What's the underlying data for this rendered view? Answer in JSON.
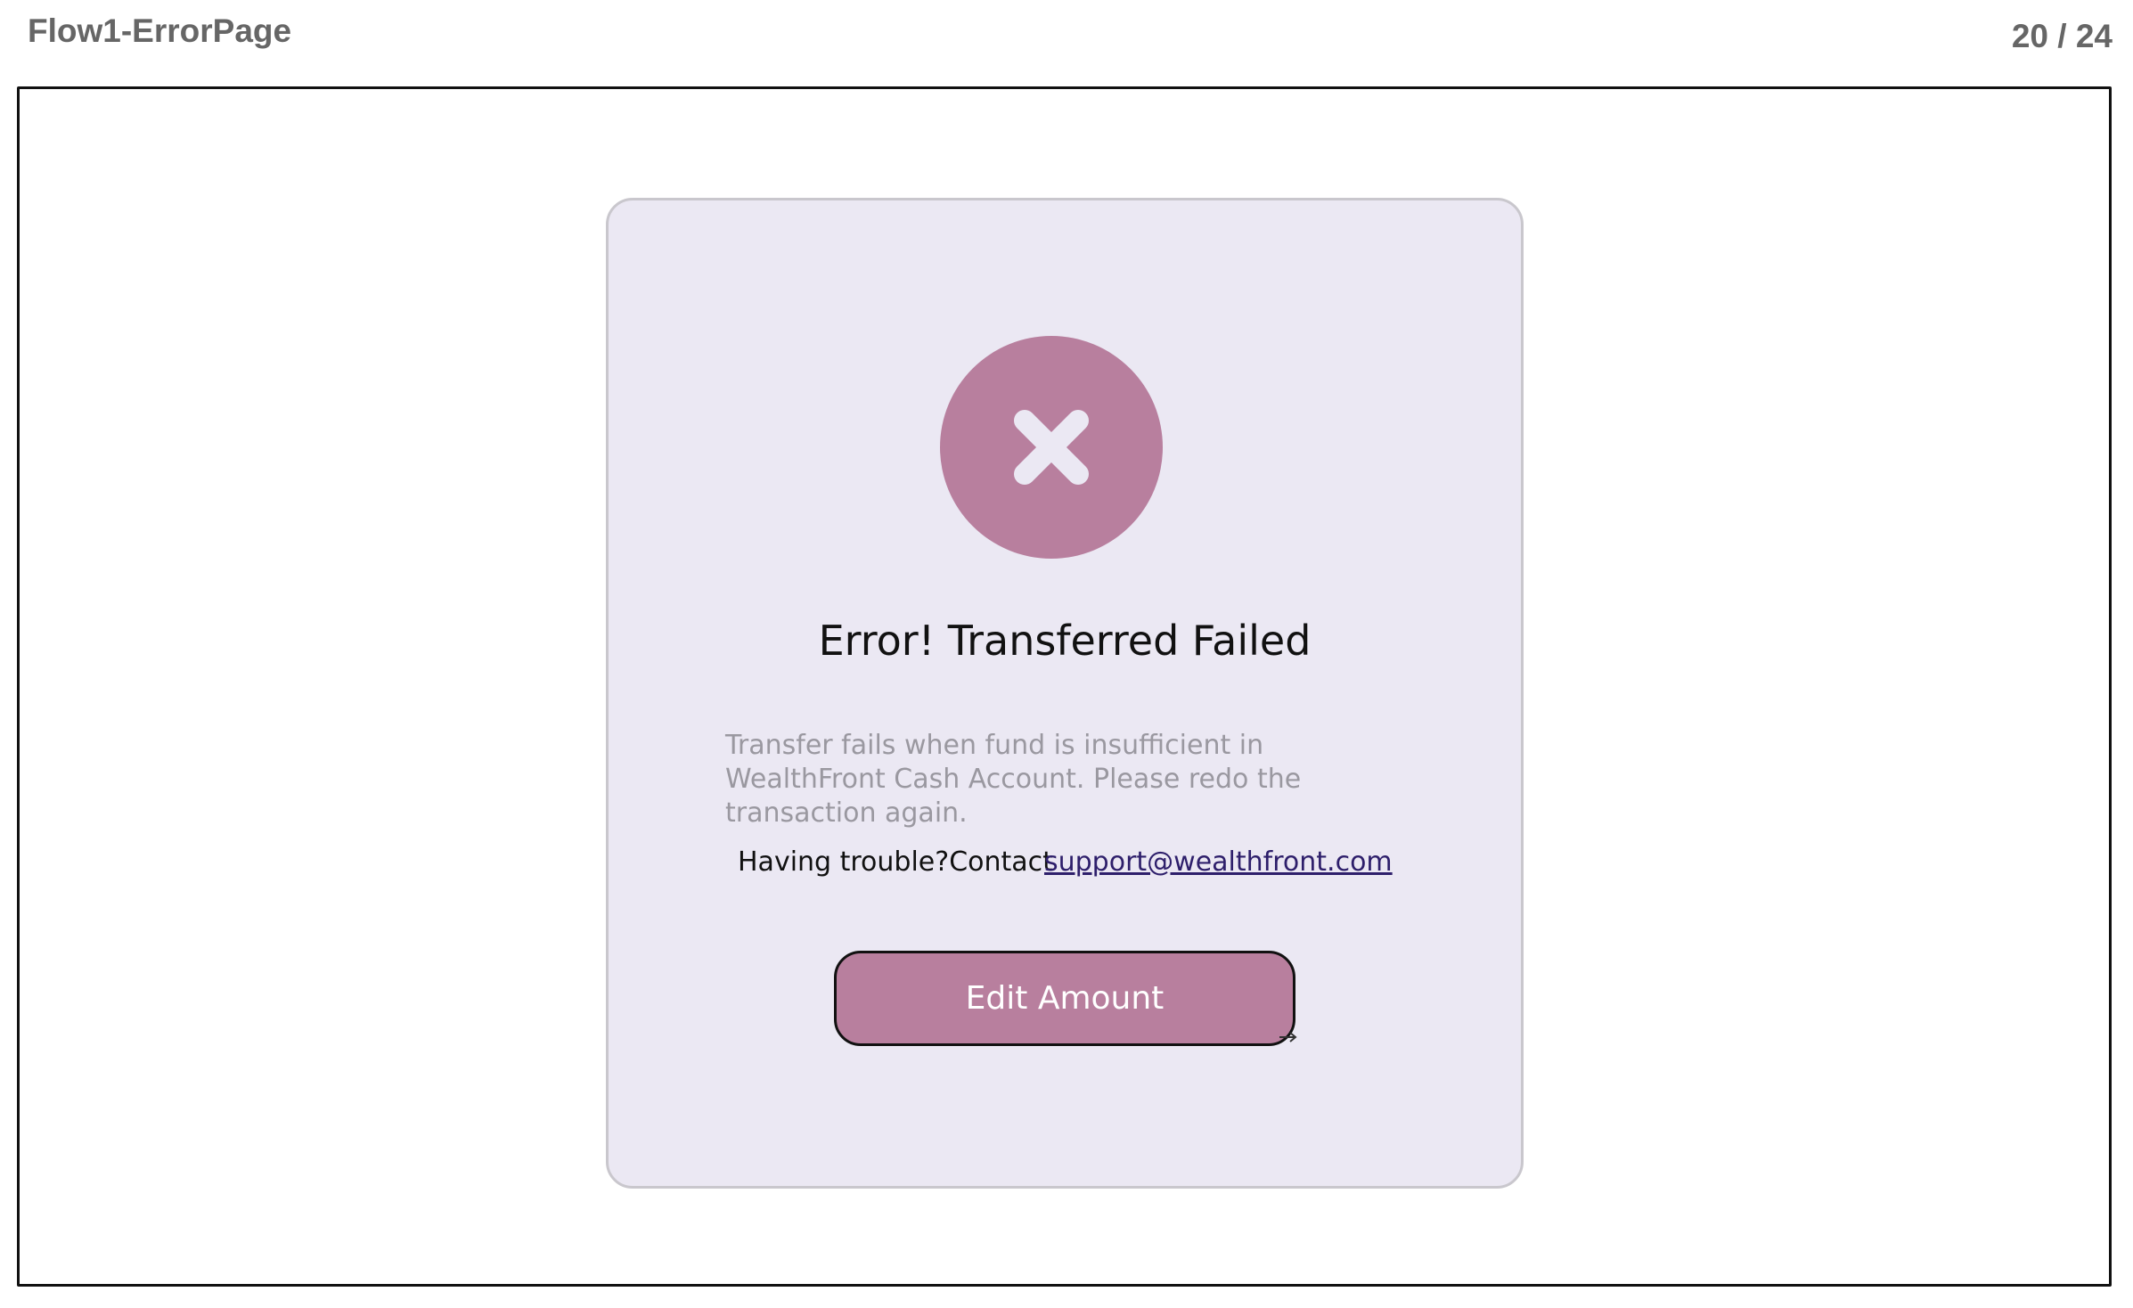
{
  "header": {
    "title": "Flow1-ErrorPage",
    "page_counter": "20 / 24"
  },
  "card": {
    "status_icon": "close-icon",
    "heading": "Error! Transferred Failed",
    "description": "Transfer fails when fund is insufficient in WealthFront Cash Account. Please redo the transaction again.",
    "support_text": "Having trouble?Contact",
    "support_email": "support@wealthfront.com",
    "button_label": "Edit Amount"
  },
  "colors": {
    "accent": "#b87f9e",
    "card_background": "#ebe8f3",
    "link": "#2e1f6b",
    "muted_text": "#9a98a0"
  }
}
